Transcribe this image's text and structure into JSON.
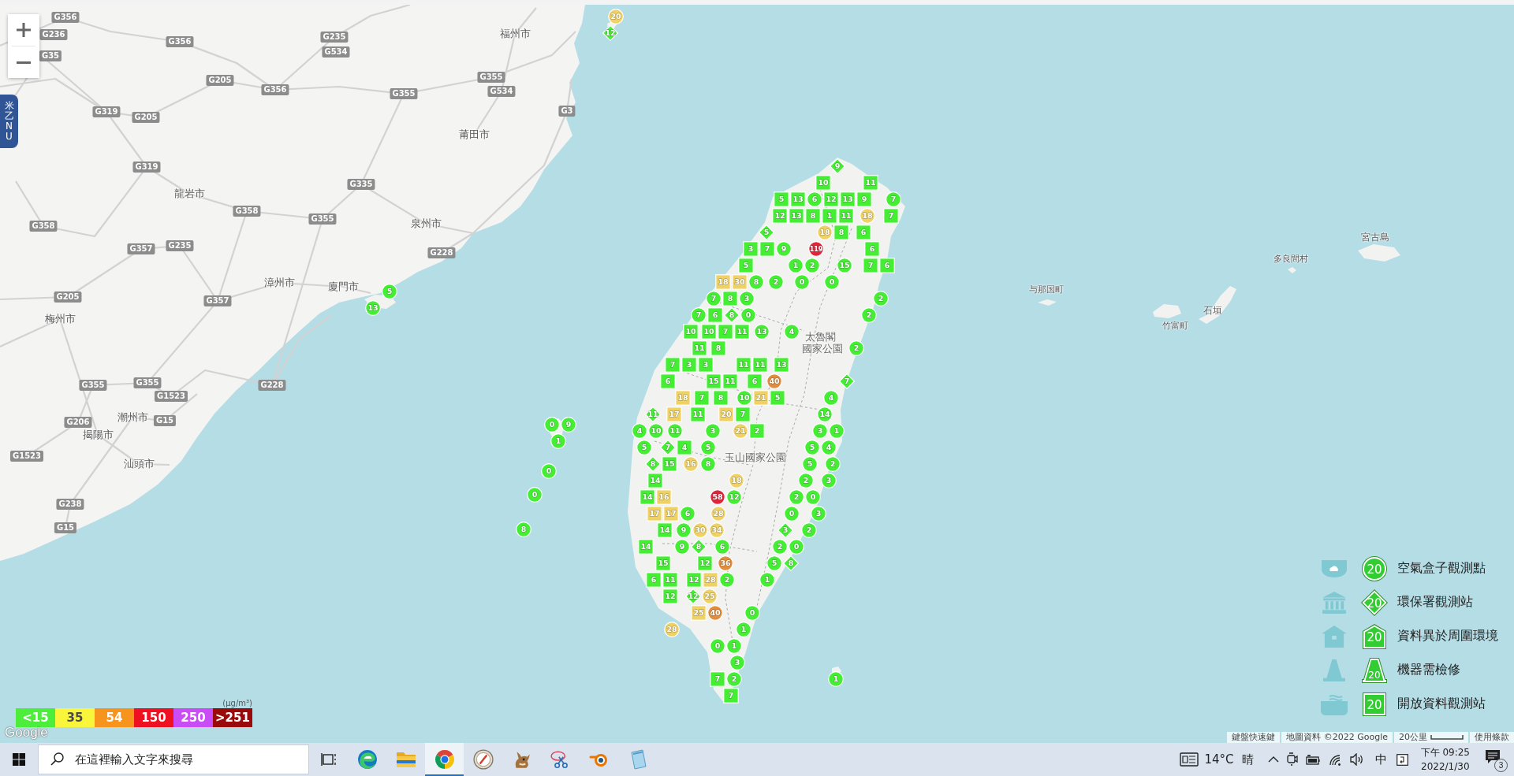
{
  "map": {
    "side_tab": "米乙NU",
    "places": [
      {
        "name": "福州市",
        "kind": "city"
      },
      {
        "name": "莆田市",
        "kind": "city"
      },
      {
        "name": "龍岩市",
        "kind": "city"
      },
      {
        "name": "泉州市",
        "kind": "city"
      },
      {
        "name": "漳州市",
        "kind": "city"
      },
      {
        "name": "廈門市",
        "kind": "city"
      },
      {
        "name": "梅州市",
        "kind": "city"
      },
      {
        "name": "潮州市",
        "kind": "city"
      },
      {
        "name": "揭陽市",
        "kind": "city"
      },
      {
        "name": "汕頭市",
        "kind": "city"
      },
      {
        "name": "宮古島",
        "kind": "island"
      },
      {
        "name": "多良間村",
        "kind": "town"
      },
      {
        "name": "与那国町",
        "kind": "town"
      },
      {
        "name": "石垣",
        "kind": "island"
      },
      {
        "name": "竹富町",
        "kind": "town"
      },
      {
        "name": "太魯閣",
        "kind": "park"
      },
      {
        "name": "國家公園",
        "kind": "park"
      },
      {
        "name": "玉山國家公園",
        "kind": "park"
      }
    ],
    "road_numbers": [
      "G356",
      "G236",
      "G35",
      "G356",
      "G235",
      "G534",
      "G355",
      "G534",
      "G3",
      "G205",
      "G356",
      "G355",
      "G319",
      "G205",
      "G319",
      "G335",
      "G358",
      "G355",
      "G358",
      "G235",
      "G357",
      "G228",
      "G205",
      "G357",
      "G355",
      "G355",
      "G1523",
      "G228",
      "G206",
      "G15",
      "G1523",
      "G238",
      "G15"
    ],
    "markers": [
      {
        "value": "20",
        "kind": "circle",
        "color": "#f0d264"
      },
      {
        "value": "12",
        "kind": "diamond",
        "color": "#44ee33"
      },
      {
        "value": "5",
        "kind": "circle",
        "color": "#44ee33"
      },
      {
        "value": "13",
        "kind": "circle",
        "color": "#44ee33"
      },
      {
        "value": "0",
        "kind": "circle",
        "color": "#44ee33"
      },
      {
        "value": "9",
        "kind": "circle",
        "color": "#44ee33"
      },
      {
        "value": "1",
        "kind": "circle",
        "color": "#44ee33"
      },
      {
        "value": "0",
        "kind": "circle",
        "color": "#44ee33"
      },
      {
        "value": "0",
        "kind": "circle",
        "color": "#44ee33"
      },
      {
        "value": "8",
        "kind": "circle",
        "color": "#44ee33"
      },
      {
        "value": "9",
        "kind": "diamond",
        "color": "#44ee33"
      },
      {
        "value": "10",
        "kind": "square",
        "color": "#44ee33"
      },
      {
        "value": "11",
        "kind": "square",
        "color": "#44ee33"
      },
      {
        "value": "5",
        "kind": "square",
        "color": "#44ee33"
      },
      {
        "value": "13",
        "kind": "square",
        "color": "#44ee33"
      },
      {
        "value": "6",
        "kind": "circle",
        "color": "#44ee33"
      },
      {
        "value": "12",
        "kind": "square",
        "color": "#44ee33"
      },
      {
        "value": "13",
        "kind": "square",
        "color": "#44ee33"
      },
      {
        "value": "9",
        "kind": "square",
        "color": "#44ee33"
      },
      {
        "value": "7",
        "kind": "circle",
        "color": "#44ee33"
      },
      {
        "value": "12",
        "kind": "square",
        "color": "#44ee33"
      },
      {
        "value": "13",
        "kind": "square",
        "color": "#44ee33"
      },
      {
        "value": "8",
        "kind": "square",
        "color": "#44ee33"
      },
      {
        "value": "1",
        "kind": "square",
        "color": "#44ee33"
      },
      {
        "value": "11",
        "kind": "square",
        "color": "#44ee33"
      },
      {
        "value": "18",
        "kind": "circle",
        "color": "#f0d264"
      },
      {
        "value": "7",
        "kind": "square",
        "color": "#44ee33"
      },
      {
        "value": "5",
        "kind": "diamond",
        "color": "#44ee33"
      },
      {
        "value": "18",
        "kind": "circle",
        "color": "#f0d264"
      },
      {
        "value": "8",
        "kind": "square",
        "color": "#44ee33"
      },
      {
        "value": "6",
        "kind": "square",
        "color": "#44ee33"
      },
      {
        "value": "3",
        "kind": "square",
        "color": "#44ee33"
      },
      {
        "value": "7",
        "kind": "square",
        "color": "#44ee33"
      },
      {
        "value": "9",
        "kind": "circle",
        "color": "#44ee33"
      },
      {
        "value": "119",
        "kind": "circle",
        "color": "#e0253a"
      },
      {
        "value": "6",
        "kind": "square",
        "color": "#44ee33"
      },
      {
        "value": "5",
        "kind": "square",
        "color": "#44ee33"
      },
      {
        "value": "1",
        "kind": "circle",
        "color": "#44ee33"
      },
      {
        "value": "2",
        "kind": "circle",
        "color": "#44ee33"
      },
      {
        "value": "15",
        "kind": "circle",
        "color": "#44ee33"
      },
      {
        "value": "7",
        "kind": "square",
        "color": "#44ee33"
      },
      {
        "value": "6",
        "kind": "square",
        "color": "#44ee33"
      },
      {
        "value": "18",
        "kind": "square",
        "color": "#f0d264"
      },
      {
        "value": "30",
        "kind": "square",
        "color": "#f0d264"
      },
      {
        "value": "8",
        "kind": "circle",
        "color": "#44ee33"
      },
      {
        "value": "2",
        "kind": "circle",
        "color": "#44ee33"
      },
      {
        "value": "0",
        "kind": "circle",
        "color": "#44ee33"
      },
      {
        "value": "0",
        "kind": "circle",
        "color": "#44ee33"
      },
      {
        "value": "7",
        "kind": "circle",
        "color": "#44ee33"
      },
      {
        "value": "8",
        "kind": "square",
        "color": "#44ee33"
      },
      {
        "value": "3",
        "kind": "circle",
        "color": "#44ee33"
      },
      {
        "value": "2",
        "kind": "circle",
        "color": "#44ee33"
      },
      {
        "value": "7",
        "kind": "circle",
        "color": "#44ee33"
      },
      {
        "value": "6",
        "kind": "square",
        "color": "#44ee33"
      },
      {
        "value": "8",
        "kind": "diamond",
        "color": "#44ee33"
      },
      {
        "value": "0",
        "kind": "circle",
        "color": "#44ee33"
      },
      {
        "value": "2",
        "kind": "circle",
        "color": "#44ee33"
      },
      {
        "value": "10",
        "kind": "square",
        "color": "#44ee33"
      },
      {
        "value": "10",
        "kind": "square",
        "color": "#44ee33"
      },
      {
        "value": "7",
        "kind": "square",
        "color": "#44ee33"
      },
      {
        "value": "11",
        "kind": "square",
        "color": "#44ee33"
      },
      {
        "value": "13",
        "kind": "circle",
        "color": "#44ee33"
      },
      {
        "value": "4",
        "kind": "circle",
        "color": "#44ee33"
      },
      {
        "value": "11",
        "kind": "square",
        "color": "#44ee33"
      },
      {
        "value": "8",
        "kind": "square",
        "color": "#44ee33"
      },
      {
        "value": "2",
        "kind": "circle",
        "color": "#44ee33"
      },
      {
        "value": "7",
        "kind": "square",
        "color": "#44ee33"
      },
      {
        "value": "3",
        "kind": "square",
        "color": "#44ee33"
      },
      {
        "value": "3",
        "kind": "square",
        "color": "#44ee33"
      },
      {
        "value": "11",
        "kind": "square",
        "color": "#44ee33"
      },
      {
        "value": "11",
        "kind": "square",
        "color": "#44ee33"
      },
      {
        "value": "13",
        "kind": "square",
        "color": "#44ee33"
      },
      {
        "value": "6",
        "kind": "square",
        "color": "#44ee33"
      },
      {
        "value": "15",
        "kind": "square",
        "color": "#44ee33"
      },
      {
        "value": "11",
        "kind": "square",
        "color": "#44ee33"
      },
      {
        "value": "6",
        "kind": "square",
        "color": "#44ee33"
      },
      {
        "value": "40",
        "kind": "circle",
        "color": "#e08d3c"
      },
      {
        "value": "7",
        "kind": "diamond",
        "color": "#44ee33"
      },
      {
        "value": "18",
        "kind": "square",
        "color": "#f0d264"
      },
      {
        "value": "7",
        "kind": "square",
        "color": "#44ee33"
      },
      {
        "value": "8",
        "kind": "square",
        "color": "#44ee33"
      },
      {
        "value": "10",
        "kind": "circle",
        "color": "#44ee33"
      },
      {
        "value": "21",
        "kind": "square",
        "color": "#f0d264"
      },
      {
        "value": "5",
        "kind": "square",
        "color": "#44ee33"
      },
      {
        "value": "4",
        "kind": "circle",
        "color": "#44ee33"
      },
      {
        "value": "11",
        "kind": "diamond",
        "color": "#44ee33"
      },
      {
        "value": "17",
        "kind": "square",
        "color": "#f0d264"
      },
      {
        "value": "11",
        "kind": "square",
        "color": "#44ee33"
      },
      {
        "value": "20",
        "kind": "square",
        "color": "#f0d264"
      },
      {
        "value": "7",
        "kind": "square",
        "color": "#44ee33"
      },
      {
        "value": "14",
        "kind": "circle",
        "color": "#44ee33"
      },
      {
        "value": "4",
        "kind": "circle",
        "color": "#44ee33"
      },
      {
        "value": "10",
        "kind": "circle",
        "color": "#44ee33"
      },
      {
        "value": "11",
        "kind": "circle",
        "color": "#44ee33"
      },
      {
        "value": "3",
        "kind": "circle",
        "color": "#44ee33"
      },
      {
        "value": "21",
        "kind": "circle",
        "color": "#f0d264"
      },
      {
        "value": "2",
        "kind": "square",
        "color": "#44ee33"
      },
      {
        "value": "3",
        "kind": "circle",
        "color": "#44ee33"
      },
      {
        "value": "1",
        "kind": "circle",
        "color": "#44ee33"
      },
      {
        "value": "5",
        "kind": "circle",
        "color": "#44ee33"
      },
      {
        "value": "7",
        "kind": "diamond",
        "color": "#44ee33"
      },
      {
        "value": "4",
        "kind": "square",
        "color": "#44ee33"
      },
      {
        "value": "5",
        "kind": "circle",
        "color": "#44ee33"
      },
      {
        "value": "5",
        "kind": "circle",
        "color": "#44ee33"
      },
      {
        "value": "4",
        "kind": "circle",
        "color": "#44ee33"
      },
      {
        "value": "8",
        "kind": "diamond",
        "color": "#44ee33"
      },
      {
        "value": "15",
        "kind": "square",
        "color": "#44ee33"
      },
      {
        "value": "16",
        "kind": "circle",
        "color": "#f0d264"
      },
      {
        "value": "8",
        "kind": "circle",
        "color": "#44ee33"
      },
      {
        "value": "5",
        "kind": "circle",
        "color": "#44ee33"
      },
      {
        "value": "2",
        "kind": "circle",
        "color": "#44ee33"
      },
      {
        "value": "14",
        "kind": "square",
        "color": "#44ee33"
      },
      {
        "value": "18",
        "kind": "circle",
        "color": "#f0d264"
      },
      {
        "value": "2",
        "kind": "circle",
        "color": "#44ee33"
      },
      {
        "value": "3",
        "kind": "circle",
        "color": "#44ee33"
      },
      {
        "value": "14",
        "kind": "square",
        "color": "#44ee33"
      },
      {
        "value": "16",
        "kind": "square",
        "color": "#f0d264"
      },
      {
        "value": "58",
        "kind": "circle",
        "color": "#e0253a"
      },
      {
        "value": "12",
        "kind": "circle",
        "color": "#44ee33"
      },
      {
        "value": "2",
        "kind": "circle",
        "color": "#44ee33"
      },
      {
        "value": "0",
        "kind": "circle",
        "color": "#44ee33"
      },
      {
        "value": "17",
        "kind": "square",
        "color": "#f0d264"
      },
      {
        "value": "17",
        "kind": "square",
        "color": "#f0d264"
      },
      {
        "value": "6",
        "kind": "circle",
        "color": "#44ee33"
      },
      {
        "value": "28",
        "kind": "circle",
        "color": "#f0d264"
      },
      {
        "value": "0",
        "kind": "circle",
        "color": "#44ee33"
      },
      {
        "value": "3",
        "kind": "circle",
        "color": "#44ee33"
      },
      {
        "value": "14",
        "kind": "square",
        "color": "#44ee33"
      },
      {
        "value": "9",
        "kind": "circle",
        "color": "#44ee33"
      },
      {
        "value": "30",
        "kind": "circle",
        "color": "#f0d264"
      },
      {
        "value": "34",
        "kind": "circle",
        "color": "#f0d264"
      },
      {
        "value": "3",
        "kind": "diamond",
        "color": "#44ee33"
      },
      {
        "value": "2",
        "kind": "circle",
        "color": "#44ee33"
      },
      {
        "value": "14",
        "kind": "square",
        "color": "#44ee33"
      },
      {
        "value": "9",
        "kind": "circle",
        "color": "#44ee33"
      },
      {
        "value": "8",
        "kind": "diamond",
        "color": "#44ee33"
      },
      {
        "value": "6",
        "kind": "circle",
        "color": "#44ee33"
      },
      {
        "value": "2",
        "kind": "circle",
        "color": "#44ee33"
      },
      {
        "value": "0",
        "kind": "circle",
        "color": "#44ee33"
      },
      {
        "value": "15",
        "kind": "square",
        "color": "#44ee33"
      },
      {
        "value": "12",
        "kind": "square",
        "color": "#44ee33"
      },
      {
        "value": "36",
        "kind": "circle",
        "color": "#e08d3c"
      },
      {
        "value": "5",
        "kind": "circle",
        "color": "#44ee33"
      },
      {
        "value": "8",
        "kind": "diamond",
        "color": "#44ee33"
      },
      {
        "value": "6",
        "kind": "square",
        "color": "#44ee33"
      },
      {
        "value": "11",
        "kind": "square",
        "color": "#44ee33"
      },
      {
        "value": "12",
        "kind": "square",
        "color": "#44ee33"
      },
      {
        "value": "28",
        "kind": "square",
        "color": "#f0d264"
      },
      {
        "value": "2",
        "kind": "circle",
        "color": "#44ee33"
      },
      {
        "value": "1",
        "kind": "circle",
        "color": "#44ee33"
      },
      {
        "value": "12",
        "kind": "square",
        "color": "#44ee33"
      },
      {
        "value": "12",
        "kind": "diamond",
        "color": "#44ee33"
      },
      {
        "value": "25",
        "kind": "circle",
        "color": "#f0d264"
      },
      {
        "value": "25",
        "kind": "square",
        "color": "#f0d264"
      },
      {
        "value": "40",
        "kind": "circle",
        "color": "#e08d3c"
      },
      {
        "value": "0",
        "kind": "circle",
        "color": "#44ee33"
      },
      {
        "value": "28",
        "kind": "circle",
        "color": "#f0d264"
      },
      {
        "value": "1",
        "kind": "circle",
        "color": "#44ee33"
      },
      {
        "value": "0",
        "kind": "circle",
        "color": "#44ee33"
      },
      {
        "value": "1",
        "kind": "circle",
        "color": "#44ee33"
      },
      {
        "value": "3",
        "kind": "circle",
        "color": "#44ee33"
      },
      {
        "value": "7",
        "kind": "square",
        "color": "#44ee33"
      },
      {
        "value": "2",
        "kind": "circle",
        "color": "#44ee33"
      },
      {
        "value": "1",
        "kind": "circle",
        "color": "#44ee33"
      },
      {
        "value": "7",
        "kind": "square",
        "color": "#44ee33"
      }
    ],
    "pm25_scale": {
      "unit": "(μg/m³)",
      "items": [
        {
          "label": "<15",
          "color": "#4ded3c"
        },
        {
          "label": "35",
          "color": "#f9f53a"
        },
        {
          "label": "54",
          "color": "#f7941d"
        },
        {
          "label": "150",
          "color": "#ee1122"
        },
        {
          "label": "250",
          "color": "#c94cf5"
        },
        {
          "label": ">251",
          "color": "#9b0a0a"
        }
      ]
    },
    "logo": "Google",
    "legend": [
      {
        "kind": "circle",
        "sample": "20",
        "label": "空氣盒子觀測點"
      },
      {
        "kind": "diamond",
        "sample": "20",
        "label": "環保署觀測站"
      },
      {
        "kind": "house",
        "sample": "20",
        "label": "資料異於周圍環境"
      },
      {
        "kind": "cone",
        "sample": "20",
        "label": "機器需檢修"
      },
      {
        "kind": "square",
        "sample": "20",
        "label": "開放資料觀測站"
      }
    ],
    "attribution": {
      "shortcuts": "鍵盤快速鍵",
      "data": "地圖資料 ©2022 Google",
      "scale": "20公里",
      "terms": "使用條款"
    }
  },
  "taskbar": {
    "search_placeholder": "在這裡輸入文字來搜尋",
    "apps": [
      {
        "kind": "edge",
        "selected": false
      },
      {
        "kind": "folder",
        "selected": false
      },
      {
        "kind": "chrome",
        "selected": true
      },
      {
        "kind": "compass",
        "selected": false
      },
      {
        "kind": "animal",
        "selected": false
      },
      {
        "kind": "scissors",
        "selected": false
      },
      {
        "kind": "blender",
        "selected": false
      },
      {
        "kind": "notepad",
        "selected": false
      }
    ],
    "weather": {
      "temperature": "14°C",
      "condition": "晴"
    },
    "ime": "中",
    "time": "下午 09:25",
    "date": "2022/1/30",
    "notifications": "3"
  }
}
